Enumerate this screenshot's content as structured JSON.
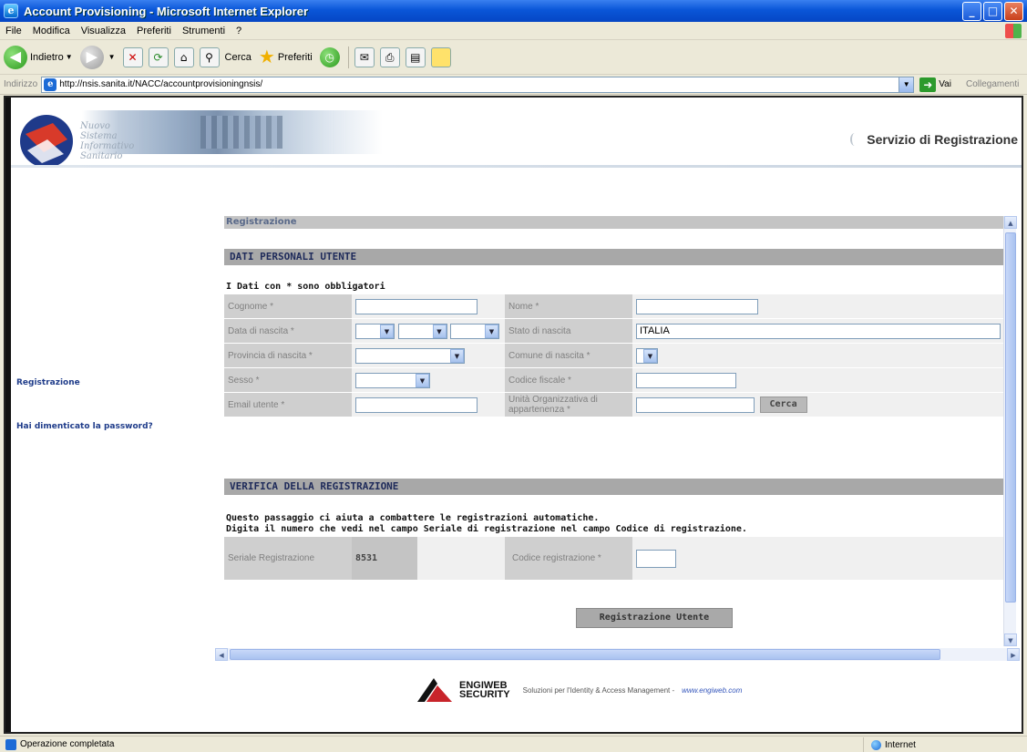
{
  "window": {
    "title": "Account Provisioning - Microsoft Internet Explorer",
    "buttons": {
      "minimize": "_",
      "maximize": "□",
      "close": "✕"
    }
  },
  "menu": [
    "File",
    "Modifica",
    "Visualizza",
    "Preferiti",
    "Strumenti",
    "?"
  ],
  "toolbar": {
    "back": "Indietro",
    "search": "Cerca",
    "favorites": "Preferiti"
  },
  "address": {
    "label": "Indirizzo",
    "url": "http://nsis.sanita.it/NACC/accountprovisioningnsis/",
    "go": "Vai",
    "links": "Collegamenti"
  },
  "banner": {
    "logo_lines": [
      "Nuovo",
      "Sistema",
      "Informativo",
      "Sanitario"
    ],
    "service_title": "Servizio di Registrazione"
  },
  "nav": {
    "registration": "Registrazione",
    "forgot_password": "Hai dimenticato la password?"
  },
  "form": {
    "page_title": "Registrazione",
    "personal_section": "DATI PERSONALI UTENTE",
    "required_note": "I Dati con * sono obbligatori",
    "labels": {
      "surname": "Cognome *",
      "name": "Nome *",
      "birth_date": "Data di nascita *",
      "birth_state": "Stato di nascita",
      "birth_province": "Provincia di nascita *",
      "birth_city": "Comune di nascita *",
      "sex": "Sesso *",
      "tax_code": "Codice fiscale *",
      "email": "Email utente *",
      "org_unit": "Unità Organizzativa di appartenenza *"
    },
    "values": {
      "birth_state": "ITALIA"
    },
    "search_button": "Cerca",
    "verify_section": "VERIFICA DELLA REGISTRAZIONE",
    "verify_note_1": "Questo passaggio ci aiuta a combattere le registrazioni automatiche.",
    "verify_note_2": "Digita il numero che vedi nel campo Seriale di registrazione nel campo Codice di registrazione.",
    "serial_label": "Seriale Registrazione",
    "serial_value": "8531",
    "code_label": "Codice registrazione *",
    "submit_button": "Registrazione Utente"
  },
  "footer": {
    "brand_line1": "ENGIWEB",
    "brand_line2": "SECURITY",
    "slogan": "Soluzioni per l'Identity & Access Management  -",
    "link": "www.engiweb.com"
  },
  "status": {
    "text": "Operazione completata",
    "zone": "Internet"
  }
}
